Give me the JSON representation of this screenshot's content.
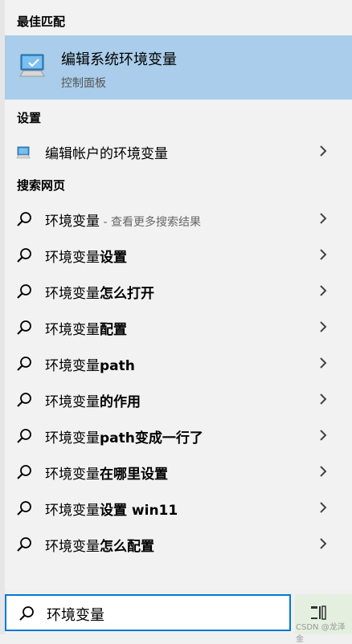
{
  "sections": {
    "best_match": "最佳匹配",
    "settings": "设置",
    "web": "搜索网页"
  },
  "best_match_item": {
    "title": "编辑系统环境变量",
    "subtitle": "控制面板"
  },
  "settings_item": {
    "label": "编辑帐户的环境变量"
  },
  "web_items": [
    {
      "prefix": "环境变量",
      "bold": "",
      "hint": " - 查看更多搜索结果"
    },
    {
      "prefix": "环境变量",
      "bold": "设置",
      "hint": ""
    },
    {
      "prefix": "环境变量",
      "bold": "怎么打开",
      "hint": ""
    },
    {
      "prefix": "环境变量",
      "bold": "配置",
      "hint": ""
    },
    {
      "prefix": "环境变量",
      "bold": "path",
      "hint": ""
    },
    {
      "prefix": "环境变量",
      "bold": "的作用",
      "hint": ""
    },
    {
      "prefix": "环境变量",
      "bold": "path变成一行了",
      "hint": ""
    },
    {
      "prefix": "环境变量",
      "bold": "在哪里设置",
      "hint": ""
    },
    {
      "prefix": "环境变量",
      "bold": "设置 win11",
      "hint": ""
    },
    {
      "prefix": "环境变量",
      "bold": "怎么配置",
      "hint": ""
    }
  ],
  "search": {
    "value": "环境变量"
  },
  "watermark": "CSDN @龙泽金",
  "colors": {
    "selected_bg": "#a9cdea",
    "accent": "#0078d7"
  },
  "icons": {
    "best_match": "monitor-icon",
    "settings": "monitor-icon",
    "web": "search-icon",
    "row_arrow": "chevron-right-icon",
    "taskview": "task-view-icon"
  }
}
